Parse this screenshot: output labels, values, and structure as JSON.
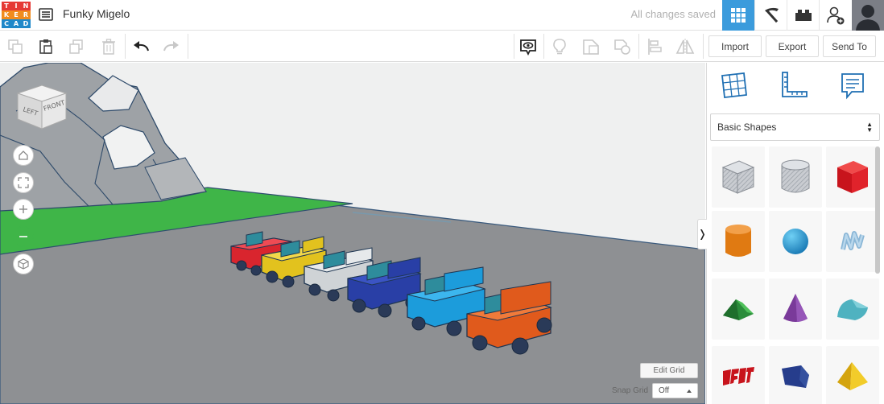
{
  "app": {
    "logo_letters": [
      "T",
      "I",
      "N",
      "K",
      "E",
      "R",
      "C",
      "A",
      "D"
    ],
    "logo_colors": [
      "#e53935",
      "#e53935",
      "#e53935",
      "#f18c1e",
      "#f18c1e",
      "#f18c1e",
      "#1f88c9",
      "#1f88c9",
      "#1f88c9"
    ],
    "document_title": "Funky Migelo",
    "save_status": "All changes saved",
    "accent_color": "#3b9bdc"
  },
  "toolbar": {
    "import_label": "Import",
    "export_label": "Export",
    "send_to_label": "Send To"
  },
  "workplane": {
    "viewcube_left": "LEFT",
    "viewcube_front": "FRONT",
    "edit_grid_label": "Edit Grid",
    "snap_grid_label": "Snap Grid",
    "snap_grid_value": "Off",
    "vehicle_colors": [
      "#d9252e",
      "#e2c21e",
      "#cfd3d6",
      "#293fa6",
      "#1c9cdb",
      "#e05a1c"
    ]
  },
  "panel": {
    "shape_category": "Basic Shapes",
    "shapes": [
      "Box",
      "Cylinder",
      "Box",
      "Cylinder",
      "Sphere",
      "Scribble",
      "Roof",
      "Cone",
      "Round Roof",
      "Text",
      "Polygon",
      "Pyramid"
    ]
  }
}
